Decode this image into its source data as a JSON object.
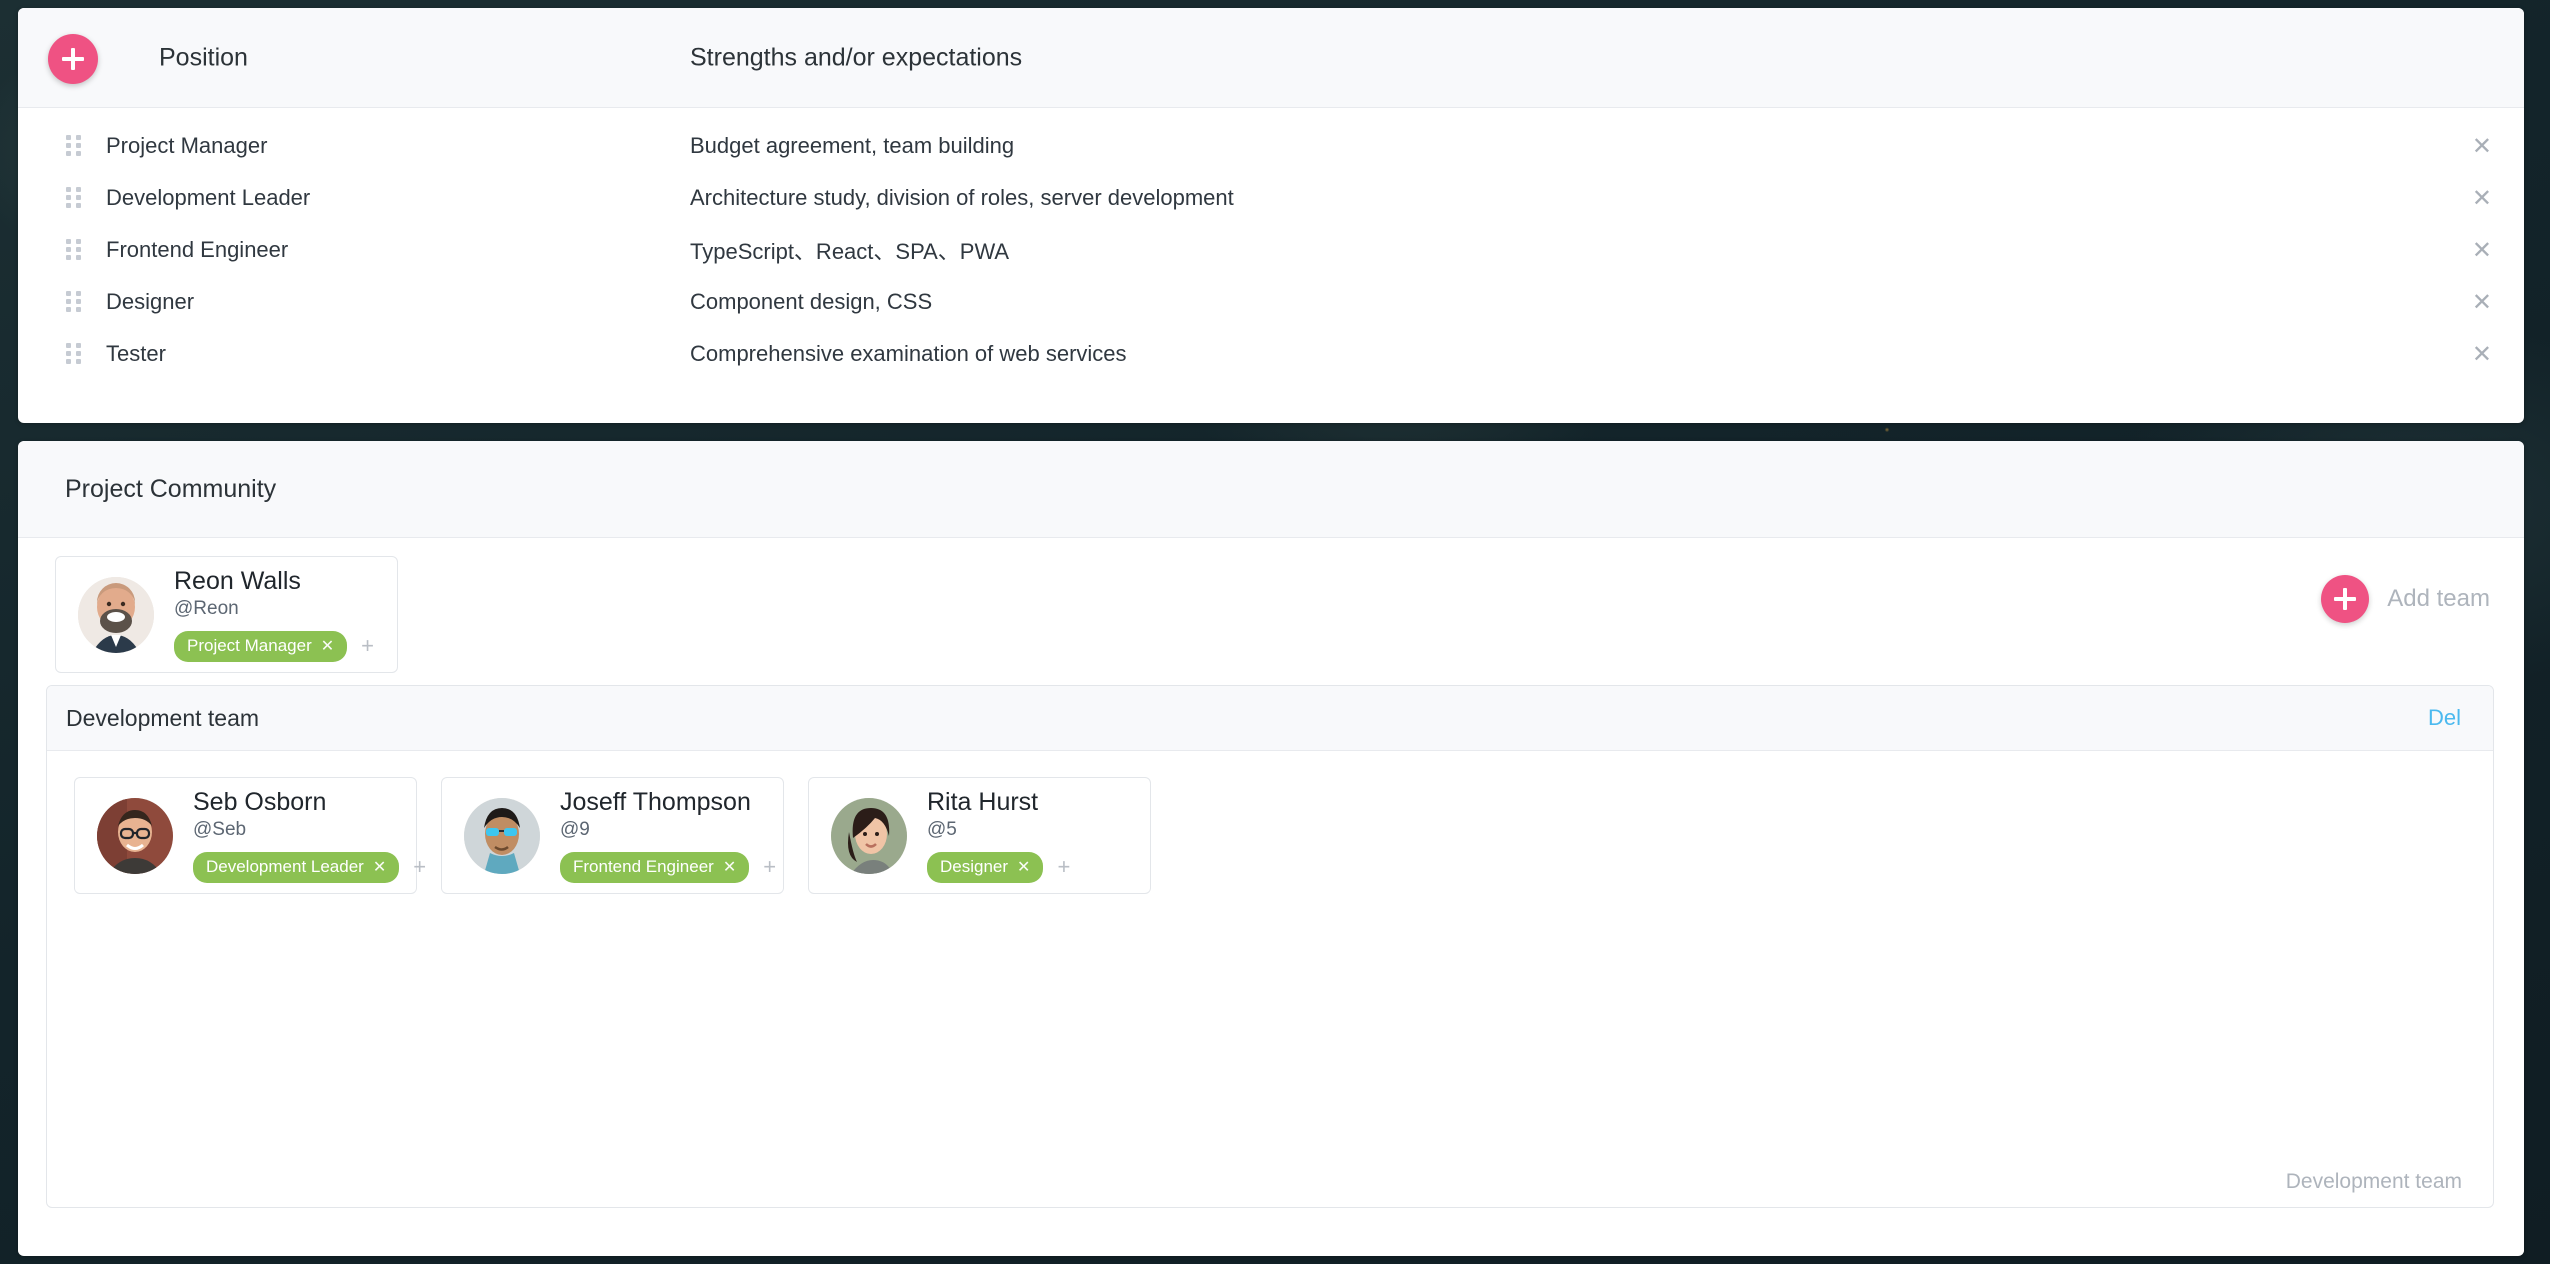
{
  "theme": {
    "accent_pink": "#ef5283",
    "tag_green": "#8cc152",
    "link_blue": "#4bb9ef",
    "muted_gray": "#aeb4bc",
    "panel_header_bg": "#f8f9fb"
  },
  "position_table": {
    "add_button_icon": "plus-icon",
    "columns": {
      "position": "Position",
      "strengths": "Strengths and/or expectations"
    },
    "rows": [
      {
        "position": "Project Manager",
        "strengths": "Budget agreement, team building"
      },
      {
        "position": "Development Leader",
        "strengths": "Architecture study, division of roles, server development"
      },
      {
        "position": "Frontend Engineer",
        "strengths": "TypeScript、React、SPA、PWA"
      },
      {
        "position": "Designer",
        "strengths": "Component design, CSS"
      },
      {
        "position": "Tester",
        "strengths": "Comprehensive examination of web services"
      }
    ],
    "row_remove_icon": "close-icon",
    "drag_handle_icon": "drag-handle-icon"
  },
  "community": {
    "title": "Project Community",
    "add_team": {
      "label": "Add team",
      "icon": "plus-icon"
    },
    "owner": {
      "name": "Reon Walls",
      "handle": "@Reon",
      "tags": [
        "Project Manager"
      ],
      "tag_remove_icon": "close-icon",
      "add_tag_label": "+"
    },
    "teams": [
      {
        "name": "Development team",
        "delete_label": "Del",
        "footer_label": "Development team",
        "members": [
          {
            "name": "Seb Osborn",
            "handle": "@Seb",
            "tags": [
              "Development Leader"
            ],
            "add_tag_label": "+"
          },
          {
            "name": "Joseff Thompson",
            "handle": "@9",
            "tags": [
              "Frontend Engineer"
            ],
            "add_tag_label": "+"
          },
          {
            "name": "Rita Hurst",
            "handle": "@5",
            "tags": [
              "Designer"
            ],
            "add_tag_label": "+"
          }
        ]
      }
    ]
  }
}
